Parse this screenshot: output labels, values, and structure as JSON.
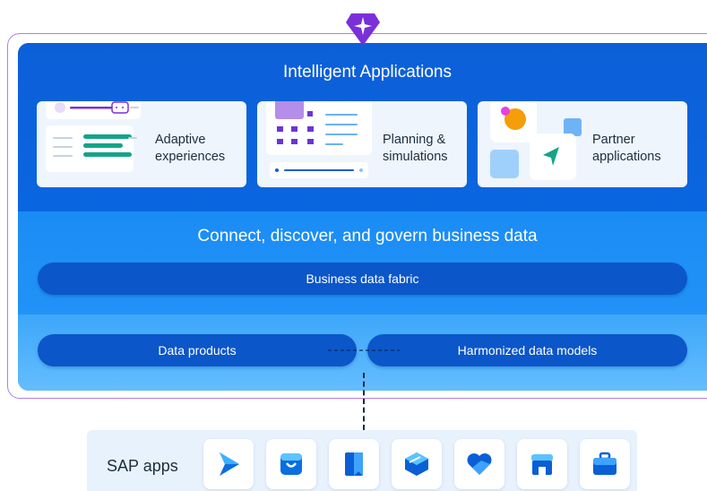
{
  "layers": {
    "apps": {
      "title": "Intelligent Applications",
      "cards": [
        {
          "line1": "Adaptive",
          "line2": "experiences"
        },
        {
          "line1": "Planning &",
          "line2": "simulations"
        },
        {
          "line1": "Partner",
          "line2": "applications"
        }
      ]
    },
    "fabric": {
      "title": "Connect, discover, and govern business data",
      "bar_label": "Business data fabric"
    },
    "models": {
      "left_label": "Data products",
      "right_label": "Harmonized data models"
    }
  },
  "sap_apps": {
    "label": "SAP apps",
    "icons": [
      "play-arrow-icon",
      "shopping-bag-icon",
      "bookmark-icon",
      "cube-icon",
      "heart-icon",
      "storefront-icon",
      "briefcase-icon"
    ]
  },
  "colors": {
    "badge": "#7b2fd8",
    "frame": "#b57ce8",
    "dark_blue": "#0a5fd6",
    "mid_blue": "#1a8cf5",
    "light_blue": "#3da7fa",
    "pill": "#0b56c9",
    "accent_green": "#14a48a"
  }
}
